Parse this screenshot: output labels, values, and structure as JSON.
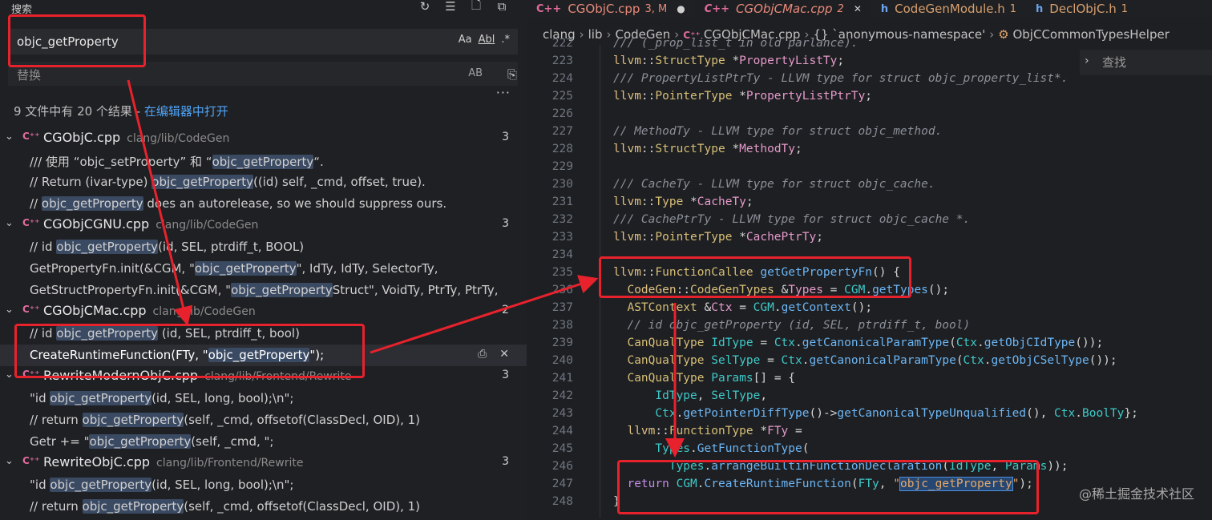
{
  "search": {
    "title": "搜索",
    "query": "objc_getProperty",
    "replace_placeholder": "替换",
    "opt_case": "Aa",
    "opt_word": "Abl",
    "opt_regex": ".*",
    "opt_preserve_case": "AB",
    "summary": "9 文件中有 20 个结果 - ",
    "open_in_editor": "在编辑器中打开"
  },
  "results": [
    {
      "file": "CGObjC.cpp",
      "path": "clang/lib/CodeGen",
      "count": "3",
      "matches": [
        [
          "/// 使用 “objc_setProperty” 和 “",
          "objc_getProperty",
          "“."
        ],
        [
          "// Return (ivar-type) ",
          "objc_getProperty",
          "((id) self, _cmd, offset, true)."
        ],
        [
          "// ",
          "objc_getProperty",
          " does an autorelease, so we should suppress ours."
        ]
      ]
    },
    {
      "file": "CGObjCGNU.cpp",
      "path": "clang/lib/CodeGen",
      "count": "3",
      "matches": [
        [
          "// id ",
          "objc_getProperty",
          "(id, SEL, ptrdiff_t, BOOL)"
        ],
        [
          "GetPropertyFn.init(&CGM, \"",
          "objc_getProperty",
          "\", IdTy, IdTy, SelectorTy,"
        ],
        [
          "GetStructPropertyFn.init(&CGM, \"",
          "objc_getProperty",
          "Struct\", VoidTy, PtrTy, PtrTy,"
        ]
      ]
    },
    {
      "file": "CGObjCMac.cpp",
      "path": "clang/lib/CodeGen",
      "count": "2",
      "matches": [
        [
          "// id ",
          "objc_getProperty",
          " (id, SEL, ptrdiff_t, bool)"
        ],
        [
          "CreateRuntimeFunction(FTy, \"",
          "objc_getProperty",
          "\");"
        ]
      ]
    },
    {
      "file": "RewriteModernObjC.cpp",
      "path": "clang/lib/Frontend/Rewrite",
      "count": "3",
      "matches": [
        [
          "\"id ",
          "objc_getProperty",
          "(id, SEL, long, bool);\\n\";"
        ],
        [
          "// return ",
          "objc_getProperty",
          "(self, _cmd, offsetof(ClassDecl, OID), 1)"
        ],
        [
          "Getr += \"",
          "objc_getProperty",
          "(self, _cmd, \";"
        ]
      ]
    },
    {
      "file": "RewriteObjC.cpp",
      "path": "clang/lib/Frontend/Rewrite",
      "count": "3",
      "matches": [
        [
          "\"id ",
          "objc_getProperty",
          "(id, SEL, long, bool);\\n\";"
        ],
        [
          "// return ",
          "objc_getProperty",
          "(self, _cmd, offsetof(ClassDecl, OID), 1)"
        ]
      ]
    }
  ],
  "tabs": [
    {
      "icon": "C++",
      "name": "CGObjC.cpp",
      "status": "3, M",
      "mark": "●"
    },
    {
      "icon": "C++",
      "name": "CGObjCMac.cpp",
      "status": "2",
      "mark": "✕"
    },
    {
      "icon": "h",
      "name": "CodeGenModule.h",
      "status": "1",
      "mark": ""
    },
    {
      "icon": "h",
      "name": "DeclObjC.h",
      "status": "1",
      "mark": ""
    }
  ],
  "breadcrumb": [
    "clang",
    "lib",
    "CodeGen",
    "CGObjCMac.cpp",
    "`anonymous-namespace'",
    "ObjCCommonTypesHelper"
  ],
  "find_placeholder": "查找",
  "watermark": "@稀土掘金技术社区",
  "code_lines": [
    {
      "n": "222",
      "c": "/// (_prop_list_t in old parlance)."
    },
    {
      "n": "223",
      "c": "llvm::StructType *PropertyListTy;"
    },
    {
      "n": "224",
      "c": "/// PropertyListPtrTy - LLVM type for struct objc_property_list*."
    },
    {
      "n": "225",
      "c": "llvm::PointerType *PropertyListPtrTy;"
    },
    {
      "n": "226",
      "c": ""
    },
    {
      "n": "227",
      "c": "// MethodTy - LLVM type for struct objc_method."
    },
    {
      "n": "228",
      "c": "llvm::StructType *MethodTy;"
    },
    {
      "n": "229",
      "c": ""
    },
    {
      "n": "230",
      "c": "/// CacheTy - LLVM type for struct objc_cache."
    },
    {
      "n": "231",
      "c": "llvm::Type *CacheTy;"
    },
    {
      "n": "232",
      "c": "/// CachePtrTy - LLVM type for struct objc_cache *."
    },
    {
      "n": "233",
      "c": "llvm::PointerType *CachePtrTy;"
    },
    {
      "n": "234",
      "c": ""
    },
    {
      "n": "235",
      "c": "llvm::FunctionCallee getGetPropertyFn() {"
    },
    {
      "n": "236",
      "c": "  CodeGen::CodeGenTypes &Types = CGM.getTypes();"
    },
    {
      "n": "237",
      "c": "  ASTContext &Ctx = CGM.getContext();"
    },
    {
      "n": "238",
      "c": "  // id objc_getProperty (id, SEL, ptrdiff_t, bool)"
    },
    {
      "n": "239",
      "c": "  CanQualType IdType = Ctx.getCanonicalParamType(Ctx.getObjCIdType());"
    },
    {
      "n": "240",
      "c": "  CanQualType SelType = Ctx.getCanonicalParamType(Ctx.getObjCSelType());"
    },
    {
      "n": "241",
      "c": "  CanQualType Params[] = {"
    },
    {
      "n": "242",
      "c": "      IdType, SelType,"
    },
    {
      "n": "243",
      "c": "      Ctx.getPointerDiffType()->getCanonicalTypeUnqualified(), Ctx.BoolTy};"
    },
    {
      "n": "244",
      "c": "  llvm::FunctionType *FTy ="
    },
    {
      "n": "245",
      "c": "      Types.GetFunctionType("
    },
    {
      "n": "246",
      "c": "        Types.arrangeBuiltinFunctionDeclaration(IdType, Params));"
    },
    {
      "n": "247",
      "c": "  return CGM.CreateRuntimeFunction(FTy, \"objc_getProperty\");"
    },
    {
      "n": "248",
      "c": "}"
    }
  ],
  "colors": {
    "annotation_red": "#e8222d",
    "link_blue": "#4fa4f8",
    "cpp_pink": "#e06c9f"
  }
}
